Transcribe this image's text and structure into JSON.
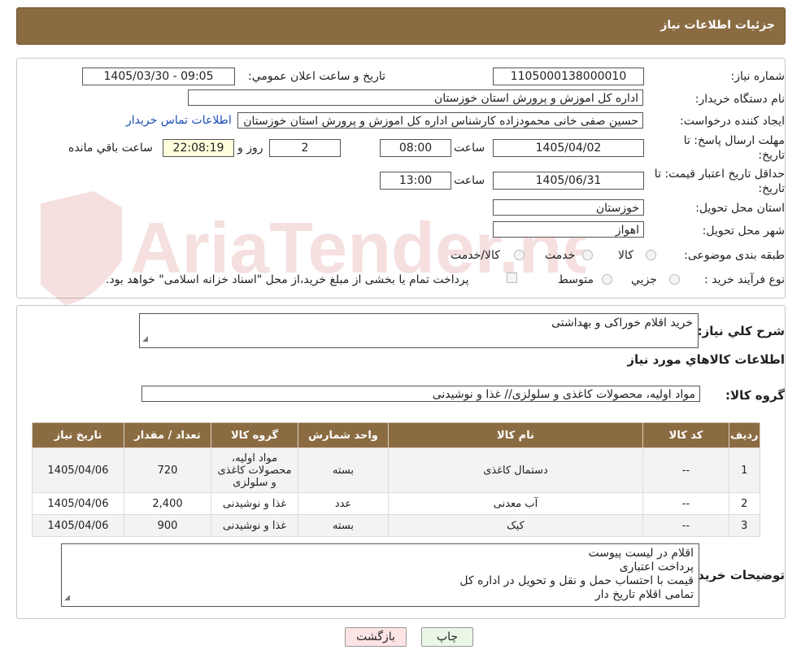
{
  "header": {
    "title": "جزئیات اطلاعات نیاز"
  },
  "form": {
    "need_number_label": "شماره نیاز:",
    "need_number": "1105000138000010",
    "announce_label": "تاریخ و ساعت اعلان عمومي:",
    "announce_value": "1405/03/30 - 09:05",
    "buyer_org_label": "نام دستگاه خریدار:",
    "buyer_org": "اداره کل اموزش و پرورش استان خوزستان",
    "requester_label": "ایجاد کننده درخواست:",
    "requester": "حسین صفی خانی محمودزاده کارشناس اداره کل اموزش و پرورش استان خوزستان",
    "contact_link": "اطلاعات تماس خریدار",
    "deadline_label_1": "مهلت ارسال پاسخ: تا",
    "deadline_label_2": "تاریخ:",
    "deadline_date": "1405/04/02",
    "time_label": "ساعت",
    "deadline_time": "08:00",
    "days_value": "2",
    "days_label": "روز و",
    "remaining_time": "22:08:19",
    "remaining_label": "ساعت باقي مانده",
    "validity_label_1": "حداقل تاریخ اعتبار قیمت: تا",
    "validity_label_2": "تاریخ:",
    "validity_date": "1405/06/31",
    "validity_time": "13:00",
    "province_label": "استان محل تحویل:",
    "province": "خوزستان",
    "city_label": "شهر محل تحویل:",
    "city": "اهواز",
    "category_label": "طبقه بندی موضوعی:",
    "category_options": [
      "کالا",
      "خدمت",
      "کالا/خدمت"
    ],
    "process_label": "نوع فرآیند خرید :",
    "process_options": [
      "جزیي",
      "متوسط"
    ],
    "payment_note": "پرداخت تمام یا بخشی از مبلغ خرید،از محل \"اسناد خزانه اسلامی\" خواهد بود."
  },
  "summary": {
    "label": "شرح کلي نیاز:",
    "value": "خرید اقلام خوراکی و بهداشتی"
  },
  "goods": {
    "section_title": "اطلاعات کالاهاي مورد نیاز",
    "group_label": "گروه کالا:",
    "group_value": "مواد اولیه، محصولات کاغذی و سلولزی// غذا و نوشیدنی",
    "columns": [
      "ردیف",
      "کد کالا",
      "نام کالا",
      "واحد شمارش",
      "گروه کالا",
      "تعداد / مقدار",
      "تاریخ نیاز"
    ],
    "rows": [
      {
        "idx": "1",
        "code": "--",
        "name": "دستمال کاغذی",
        "unit": "بسته",
        "group": "مواد اولیه، محصولات کاغذی و سلولزی",
        "qty": "720",
        "date": "1405/04/06"
      },
      {
        "idx": "2",
        "code": "--",
        "name": "آب معدنی",
        "unit": "عدد",
        "group": "غذا و نوشیدنی",
        "qty": "2,400",
        "date": "1405/04/06"
      },
      {
        "idx": "3",
        "code": "--",
        "name": "کیک",
        "unit": "بسته",
        "group": "غذا و نوشیدنی",
        "qty": "900",
        "date": "1405/04/06"
      }
    ]
  },
  "buyer_notes": {
    "label": "توضیحات خریدار:",
    "lines": [
      "اقلام در لیست پیوست",
      "پرداخت اعتباری",
      "قیمت با احتساب حمل و نقل و تحویل در اداره کل",
      "تمامی اقلام تاریخ دار"
    ]
  },
  "buttons": {
    "print": "چاپ",
    "back": "بازگشت"
  },
  "watermark": {
    "text": "AriaTender.neT"
  },
  "colors": {
    "header": "#8b6c42",
    "link": "#1a4db8",
    "back_button": "#fde4e4",
    "print_button": "#eaf7e6"
  }
}
